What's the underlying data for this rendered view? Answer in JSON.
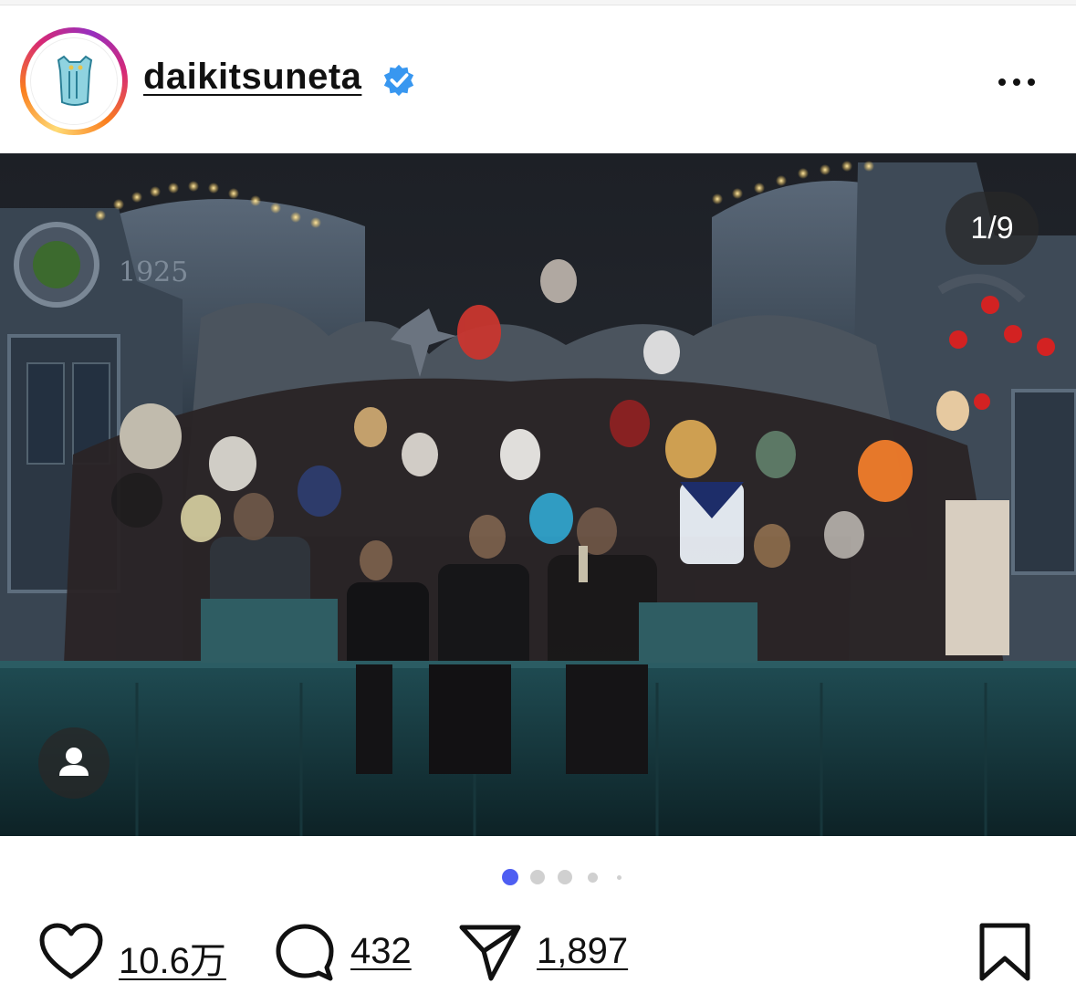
{
  "post": {
    "username": "daikitsuneta",
    "verified": true,
    "carousel_counter": "1/9",
    "carousel_dots": 5,
    "active_dot": 0
  },
  "actions": {
    "likes": "10.6万",
    "comments": "432",
    "shares": "1,897"
  },
  "icons": {
    "more": "more-options-icon",
    "verified": "verified-badge-icon",
    "tag": "user-tag-icon",
    "like": "heart-icon",
    "comment": "comment-bubble-icon",
    "share": "paper-plane-icon",
    "save": "bookmark-icon"
  },
  "colors": {
    "accent_blue": "#4e5ef2",
    "verified_blue": "#3897f0",
    "dot_inactive": "#d0d0d0"
  }
}
